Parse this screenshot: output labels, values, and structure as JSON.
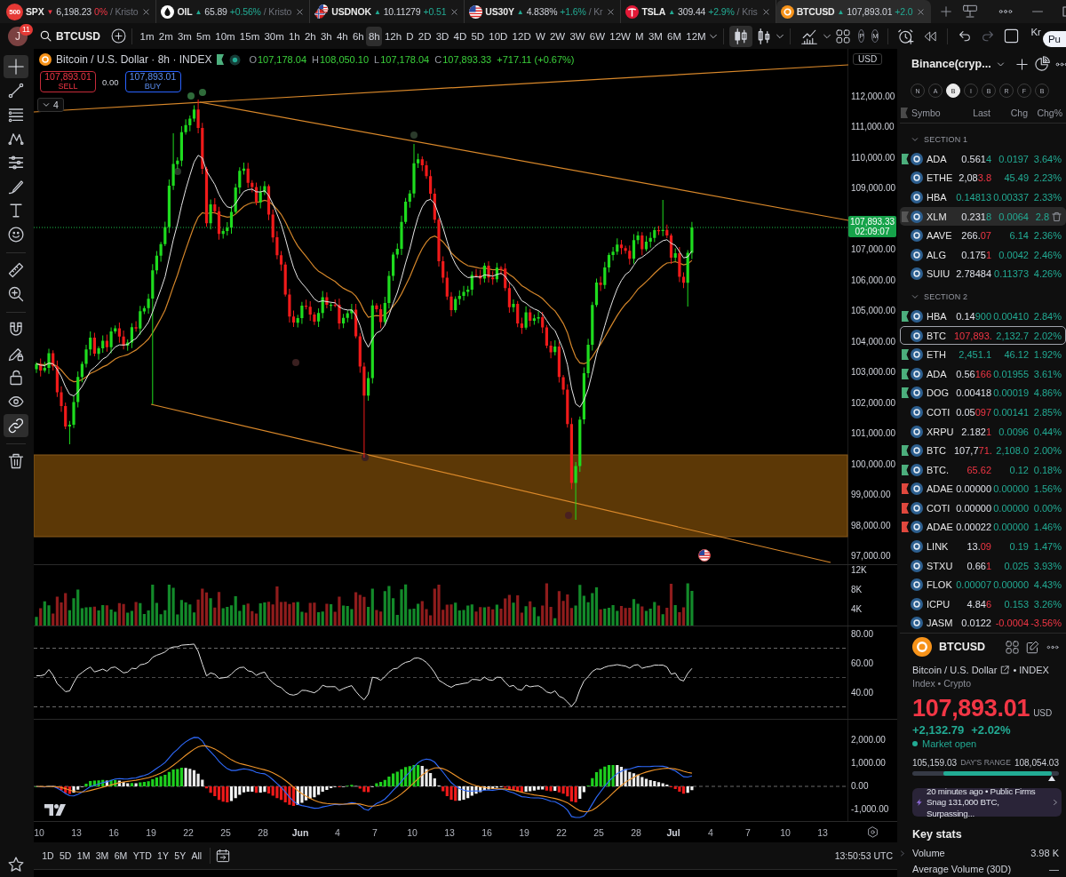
{
  "tabs": [
    {
      "kind": "index",
      "logo_text": "500",
      "symbol": "SPX",
      "arrow": "▼",
      "price": "6,198.23",
      "change": "0%",
      "negative": true,
      "owner": "/ Kristo",
      "selected": false
    },
    {
      "kind": "commodity",
      "symbol": "OIL",
      "arrow": "▲",
      "price": "65.89",
      "change": "+0.56%",
      "negative": false,
      "owner": "/ Kristo",
      "selected": false
    },
    {
      "kind": "forex",
      "symbol": "USDNOK",
      "arrow": "▲",
      "price": "10.11279",
      "change": "+0.51",
      "negative": false,
      "selected": false
    },
    {
      "kind": "bond",
      "symbol": "US30Y",
      "arrow": "▲",
      "price": "4.838%",
      "change": "+1.6%",
      "negative": false,
      "owner": "/ Kr",
      "selected": false
    },
    {
      "kind": "stock",
      "symbol": "TSLA",
      "arrow": "▲",
      "price": "309.44",
      "change": "+2.9%",
      "negative": false,
      "owner": "/ Kris",
      "selected": false
    },
    {
      "kind": "crypto",
      "symbol": "BTCUSD",
      "arrow": "▲",
      "price": "107,893.01",
      "change": "+2.0",
      "negative": false,
      "selected": true
    }
  ],
  "toolbar": {
    "avatar": "J",
    "notifications": "11",
    "symbol": "BTCUSD",
    "intervals": [
      {
        "label": "1m",
        "selected": false
      },
      {
        "label": "2m",
        "selected": false
      },
      {
        "label": "3m",
        "selected": false
      },
      {
        "label": "5m",
        "selected": false
      },
      {
        "label": "10m",
        "selected": false
      },
      {
        "label": "15m",
        "selected": false
      },
      {
        "label": "30m",
        "selected": false
      },
      {
        "label": "1h",
        "selected": false
      },
      {
        "label": "2h",
        "selected": false
      },
      {
        "label": "3h",
        "selected": false
      },
      {
        "label": "4h",
        "selected": false
      },
      {
        "label": "6h",
        "selected": false
      },
      {
        "label": "8h",
        "selected": true
      },
      {
        "label": "12h",
        "selected": false
      },
      {
        "label": "D",
        "selected": false
      },
      {
        "label": "2D",
        "selected": false
      },
      {
        "label": "3D",
        "selected": false
      },
      {
        "label": "4D",
        "selected": false
      },
      {
        "label": "5D",
        "selected": false
      },
      {
        "label": "10D",
        "selected": false
      },
      {
        "label": "12D",
        "selected": false
      },
      {
        "label": "W",
        "selected": false
      },
      {
        "label": "2W",
        "selected": false
      },
      {
        "label": "3W",
        "selected": false
      },
      {
        "label": "6W",
        "selected": false
      },
      {
        "label": "12W",
        "selected": false
      },
      {
        "label": "M",
        "selected": false
      },
      {
        "label": "3M",
        "selected": false
      },
      {
        "label": "6M",
        "selected": false
      },
      {
        "label": "12M",
        "selected": false
      }
    ],
    "chart_styles": [
      {
        "kind": "candles",
        "selected": true
      },
      {
        "kind": "hollow",
        "selected": false
      }
    ],
    "circle_buttons": [
      "P",
      "M"
    ],
    "history": [
      {
        "kind": "undo",
        "disabled": false
      },
      {
        "kind": "redo",
        "disabled": true
      }
    ],
    "user": "Kr",
    "action": "Pu"
  },
  "left_tool_groups": [
    {
      "tools": [
        {
          "kind": "crosshair",
          "selected": true
        },
        {
          "kind": "trend-line",
          "selected": false
        },
        {
          "kind": "fib",
          "selected": false
        },
        {
          "kind": "pattern",
          "selected": false
        },
        {
          "kind": "forecast",
          "selected": false
        },
        {
          "kind": "brush",
          "selected": false
        },
        {
          "kind": "text",
          "selected": false
        },
        {
          "kind": "emoji",
          "selected": false
        }
      ]
    },
    {
      "tools": [
        {
          "kind": "ruler",
          "selected": false
        },
        {
          "kind": "zoom",
          "selected": false
        }
      ]
    },
    {
      "tools": [
        {
          "kind": "magnet",
          "selected": false
        },
        {
          "kind": "draw-lock",
          "selected": false
        },
        {
          "kind": "lock",
          "selected": false
        },
        {
          "kind": "eye",
          "selected": false
        },
        {
          "kind": "link",
          "selected": true
        }
      ]
    },
    {
      "tools": [
        {
          "kind": "trash",
          "selected": false
        }
      ]
    }
  ],
  "left_tool_footer": {
    "kind": "star",
    "selected": false
  },
  "chart": {
    "legend": {
      "title": "Bitcoin / U.S. Dollar · 8h · INDEX",
      "ohlc": [
        {
          "label": "O",
          "value": "107,178.04"
        },
        {
          "label": "H",
          "value": "108,050.10"
        },
        {
          "label": "L",
          "value": "107,178.04"
        },
        {
          "label": "C",
          "value": "107,893.33"
        }
      ],
      "change": "+717.11 (+0.67%)",
      "negative": false
    },
    "trade": {
      "sell_price": "107,893.01",
      "sell_label": "SELL",
      "spread": "0.00",
      "buy_price": "107,893.01",
      "buy_label": "BUY"
    },
    "indicator_count": "4",
    "currency": "USD",
    "price_axis": [
      {
        "kind": "tick",
        "text": "112,000.00"
      },
      {
        "kind": "tick",
        "text": "111,000.00"
      },
      {
        "kind": "tick",
        "text": "110,000.00"
      },
      {
        "kind": "tick",
        "text": "109,000.00"
      },
      {
        "kind": "price_tag",
        "text": "107,893.33",
        "countdown": "02:09:07"
      },
      {
        "kind": "tick",
        "text": "107,000.00"
      },
      {
        "kind": "tick",
        "text": "106,000.00"
      },
      {
        "kind": "tick",
        "text": "105,000.00"
      },
      {
        "kind": "tick",
        "text": "104,000.00"
      },
      {
        "kind": "tick",
        "text": "103,000.00"
      },
      {
        "kind": "tick",
        "text": "102,000.00"
      },
      {
        "kind": "tick",
        "text": "101,000.00"
      },
      {
        "kind": "tick",
        "text": "100,000.00"
      },
      {
        "kind": "tick",
        "text": "99,000.00"
      },
      {
        "kind": "tick",
        "text": "98,000.00"
      },
      {
        "kind": "tick",
        "text": "97,000.00"
      }
    ],
    "volume_axis": [
      "12K",
      "8K",
      "4K"
    ],
    "rsi_axis": [
      "80.00",
      "60.00",
      "40.00"
    ],
    "macd_axis": [
      "2,000.00",
      "1,000.00",
      "0.00",
      "-1,000.00"
    ],
    "time_axis": [
      {
        "kind": "day",
        "text": "10"
      },
      {
        "kind": "day",
        "text": "13"
      },
      {
        "kind": "day",
        "text": "16"
      },
      {
        "kind": "day",
        "text": "19"
      },
      {
        "kind": "day",
        "text": "22"
      },
      {
        "kind": "day",
        "text": "25"
      },
      {
        "kind": "day",
        "text": "28"
      },
      {
        "kind": "month",
        "text": "Jun"
      },
      {
        "kind": "day",
        "text": "4"
      },
      {
        "kind": "day",
        "text": "7"
      },
      {
        "kind": "day",
        "text": "10"
      },
      {
        "kind": "day",
        "text": "13"
      },
      {
        "kind": "day",
        "text": "16"
      },
      {
        "kind": "day",
        "text": "19"
      },
      {
        "kind": "day",
        "text": "22"
      },
      {
        "kind": "day",
        "text": "25"
      },
      {
        "kind": "day",
        "text": "28"
      },
      {
        "kind": "month",
        "text": "Jul"
      },
      {
        "kind": "day",
        "text": "4"
      },
      {
        "kind": "day",
        "text": "7"
      },
      {
        "kind": "day",
        "text": "10"
      },
      {
        "kind": "day",
        "text": "13"
      }
    ],
    "ranges": [
      "1D",
      "5D",
      "1M",
      "3M",
      "6M",
      "YTD",
      "1Y",
      "5Y",
      "All"
    ],
    "clock": "13:50:53 UTC"
  },
  "watchlist": {
    "title": "Binance(cryp...",
    "filters": [
      {
        "label": "N",
        "selected": false
      },
      {
        "label": "A",
        "selected": false
      },
      {
        "label": "B",
        "selected": true
      },
      {
        "label": "I",
        "selected": false
      },
      {
        "label": "B",
        "selected": false
      },
      {
        "label": "R",
        "selected": false
      },
      {
        "label": "F",
        "selected": false
      },
      {
        "label": "B",
        "selected": false
      }
    ],
    "columns": [
      "Symbo",
      "Last",
      "Chg",
      "Chg%"
    ],
    "sections": [
      {
        "title": "SECTION 1",
        "expanded": true,
        "rows": [
          {
            "symbol": "ADA",
            "last": [
              {
                "text": "0.561",
                "highlighted": false
              },
              {
                "text": "4",
                "highlighted": true
              }
            ],
            "tick_down": false,
            "change": "0.0197",
            "change_pct": "3.64%",
            "negative": false,
            "color": "#4caf7d",
            "selected": false,
            "hovered": false
          },
          {
            "symbol": "ETHE",
            "last": [
              {
                "text": "2,08",
                "highlighted": false
              },
              {
                "text": "3.8",
                "highlighted": true
              }
            ],
            "tick_down": true,
            "change": "45.49",
            "change_pct": "2.23%",
            "negative": false,
            "selected": false,
            "hovered": false
          },
          {
            "symbol": "HBA",
            "last": [
              {
                "text": "0.14813",
                "highlighted": true
              }
            ],
            "tick_down": false,
            "change": "0.00337",
            "change_pct": "2.33%",
            "negative": false,
            "selected": false,
            "hovered": false
          },
          {
            "symbol": "XLM",
            "last": [
              {
                "text": "0.231",
                "highlighted": false
              },
              {
                "text": "8",
                "highlighted": true
              }
            ],
            "tick_down": false,
            "change": "0.0064",
            "change_pct": "2.8",
            "negative": false,
            "selected": false,
            "hovered": true
          },
          {
            "symbol": "AAVE",
            "last": [
              {
                "text": "266.",
                "highlighted": false
              },
              {
                "text": "07",
                "highlighted": true
              }
            ],
            "tick_down": true,
            "change": "6.14",
            "change_pct": "2.36%",
            "negative": false,
            "selected": false,
            "hovered": false
          },
          {
            "symbol": "ALG",
            "last": [
              {
                "text": "0.175",
                "highlighted": false
              },
              {
                "text": "1",
                "highlighted": true
              }
            ],
            "tick_down": true,
            "change": "0.0042",
            "change_pct": "2.46%",
            "negative": false,
            "selected": false,
            "hovered": false
          },
          {
            "symbol": "SUIU",
            "last": [
              {
                "text": "2.78484",
                "highlighted": false
              }
            ],
            "change": "0.11373",
            "change_pct": "4.26%",
            "negative": false,
            "selected": false,
            "hovered": false
          }
        ]
      },
      {
        "title": "SECTION 2",
        "expanded": true,
        "rows": [
          {
            "symbol": "HBA",
            "last": [
              {
                "text": "0.14",
                "highlighted": false
              },
              {
                "text": "900",
                "highlighted": true
              }
            ],
            "tick_down": false,
            "change": "0.00410",
            "change_pct": "2.84%",
            "negative": false,
            "color": "#4caf7d",
            "selected": false,
            "hovered": false
          },
          {
            "symbol": "BTC",
            "last": [
              {
                "text": "107,893.",
                "highlighted": true
              }
            ],
            "tick_down": true,
            "change": "2,132.7",
            "change_pct": "2.02%",
            "negative": false,
            "selected": true,
            "hovered": false
          },
          {
            "symbol": "ETH",
            "last": [
              {
                "text": "2,451.1",
                "highlighted": true
              }
            ],
            "tick_down": false,
            "change": "46.12",
            "change_pct": "1.92%",
            "negative": false,
            "color": "#4caf7d",
            "selected": false,
            "hovered": false
          },
          {
            "symbol": "ADA",
            "last": [
              {
                "text": "0.56",
                "highlighted": false
              },
              {
                "text": "166",
                "highlighted": true
              }
            ],
            "tick_down": true,
            "change": "0.01955",
            "change_pct": "3.61%",
            "negative": false,
            "color": "#4caf7d",
            "selected": false,
            "hovered": false
          },
          {
            "symbol": "DOG",
            "last": [
              {
                "text": "0.00418",
                "highlighted": false
              }
            ],
            "change": "0.00019",
            "change_pct": "4.86%",
            "negative": false,
            "color": "#4caf7d",
            "selected": false,
            "hovered": false
          },
          {
            "symbol": "COTI",
            "last": [
              {
                "text": "0.05",
                "highlighted": false
              },
              {
                "text": "097",
                "highlighted": true
              }
            ],
            "tick_down": true,
            "change": "0.00141",
            "change_pct": "2.85%",
            "negative": false,
            "selected": false,
            "hovered": false
          },
          {
            "symbol": "XRPU",
            "last": [
              {
                "text": "2.182",
                "highlighted": false
              },
              {
                "text": "1",
                "highlighted": true
              }
            ],
            "tick_down": true,
            "change": "0.0096",
            "change_pct": "0.44%",
            "negative": false,
            "selected": false,
            "hovered": false
          },
          {
            "symbol": "BTC",
            "last": [
              {
                "text": "107,7",
                "highlighted": false
              },
              {
                "text": "71.",
                "highlighted": true
              }
            ],
            "tick_down": true,
            "change": "2,108.0",
            "change_pct": "2.00%",
            "negative": false,
            "color": "#4caf7d",
            "selected": false,
            "hovered": false
          },
          {
            "symbol": "BTC.",
            "last": [
              {
                "text": "65.62",
                "highlighted": true
              }
            ],
            "tick_down": true,
            "change": "0.12",
            "change_pct": "0.18%",
            "negative": false,
            "color": "#4caf7d",
            "selected": false,
            "hovered": false
          },
          {
            "symbol": "ADAE",
            "last": [
              {
                "text": "0.00000",
                "highlighted": false
              }
            ],
            "change": "0.00000",
            "change_pct": "1.56%",
            "negative": false,
            "color": "#e0483e",
            "selected": false,
            "hovered": false
          },
          {
            "symbol": "COTI",
            "last": [
              {
                "text": "0.00000",
                "highlighted": false
              }
            ],
            "change": "0.00000",
            "change_pct": "0.00%",
            "negative": false,
            "color": "#e0483e",
            "selected": false,
            "hovered": false
          },
          {
            "symbol": "ADAE",
            "last": [
              {
                "text": "0.00022",
                "highlighted": false
              }
            ],
            "change": "0.00000",
            "change_pct": "1.46%",
            "negative": false,
            "color": "#e0483e",
            "selected": false,
            "hovered": false
          },
          {
            "symbol": "LINK",
            "last": [
              {
                "text": "13.",
                "highlighted": false
              },
              {
                "text": "09",
                "highlighted": true
              }
            ],
            "tick_down": true,
            "change": "0.19",
            "change_pct": "1.47%",
            "negative": false,
            "selected": false,
            "hovered": false
          },
          {
            "symbol": "STXU",
            "last": [
              {
                "text": "0.66",
                "highlighted": false
              },
              {
                "text": "1",
                "highlighted": true
              }
            ],
            "tick_down": true,
            "change": "0.025",
            "change_pct": "3.93%",
            "negative": false,
            "selected": false,
            "hovered": false
          },
          {
            "symbol": "FLOK",
            "last": [
              {
                "text": "0.00007",
                "highlighted": true
              }
            ],
            "tick_down": false,
            "change": "0.00000",
            "change_pct": "4.43%",
            "negative": false,
            "selected": false,
            "hovered": false
          },
          {
            "symbol": "ICPU",
            "last": [
              {
                "text": "4.84",
                "highlighted": false
              },
              {
                "text": "6",
                "highlighted": true
              }
            ],
            "tick_down": true,
            "change": "0.153",
            "change_pct": "3.26%",
            "negative": false,
            "selected": false,
            "hovered": false
          },
          {
            "symbol": "JASM",
            "last": [
              {
                "text": "0.0122",
                "highlighted": false
              }
            ],
            "change": "-0.0004",
            "change_pct": "-3.56%",
            "negative": true,
            "selected": false,
            "hovered": false
          }
        ]
      }
    ]
  },
  "details": {
    "symbol": "BTCUSD",
    "name": "Bitcoin / U.S. Dollar",
    "exchange": "• INDEX",
    "category": "Index • Crypto",
    "price": "107,893.01",
    "price_falling": true,
    "currency": "USD",
    "change": "+2,132.79",
    "change_pct": "+2.02%",
    "negative": false,
    "market_status": "Market open",
    "market_open": true,
    "day_range": {
      "low": "105,159.03",
      "label": "DAY'S RANGE",
      "high": "108,054.03",
      "level": 0.94
    },
    "news": {
      "text": "20 minutes ago • Public Firms Snag 131,000 BTC, Surpassing..."
    },
    "key_stats": {
      "title": "Key stats",
      "rows": [
        {
          "label": "Volume",
          "value": "3.98 K"
        },
        {
          "label": "Average Volume (30D)",
          "value": "—"
        }
      ]
    }
  }
}
